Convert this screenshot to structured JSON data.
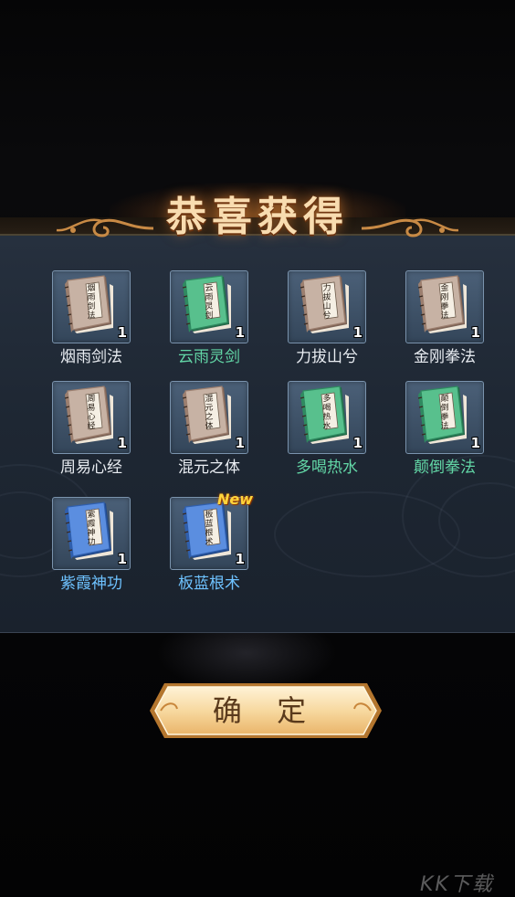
{
  "dialog": {
    "title": "恭喜获得",
    "confirm_label": "确 定",
    "new_badge": "New"
  },
  "items": [
    {
      "name": "烟雨剑法",
      "cover": "烟雨剑法",
      "count": "1",
      "rarity": "common"
    },
    {
      "name": "云雨灵剑",
      "cover": "云雨灵剑",
      "count": "1",
      "rarity": "green"
    },
    {
      "name": "力拔山兮",
      "cover": "力拔山兮",
      "count": "1",
      "rarity": "common"
    },
    {
      "name": "金刚拳法",
      "cover": "金刚拳法",
      "count": "1",
      "rarity": "common"
    },
    {
      "name": "周易心经",
      "cover": "周易心经",
      "count": "1",
      "rarity": "common"
    },
    {
      "name": "混元之体",
      "cover": "混元之体",
      "count": "1",
      "rarity": "common"
    },
    {
      "name": "多喝热水",
      "cover": "多喝热水",
      "count": "1",
      "rarity": "green"
    },
    {
      "name": "颠倒拳法",
      "cover": "颠倒拳法",
      "count": "1",
      "rarity": "green"
    },
    {
      "name": "紫霞神功",
      "cover": "紫霞神功",
      "count": "1",
      "rarity": "blue"
    },
    {
      "name": "板蓝根术",
      "cover": "板蓝根术",
      "count": "1",
      "rarity": "blue"
    }
  ],
  "colors": {
    "common_book": "#b59a89",
    "green_book": "#3fa776",
    "blue_book": "#3f74c9",
    "label_common": "#e9edf2",
    "label_green": "#62d6a6",
    "label_blue": "#6ec2ff"
  },
  "icons": [
    "scroll-ornament-icon",
    "book-icon"
  ],
  "watermark": "KK下载"
}
